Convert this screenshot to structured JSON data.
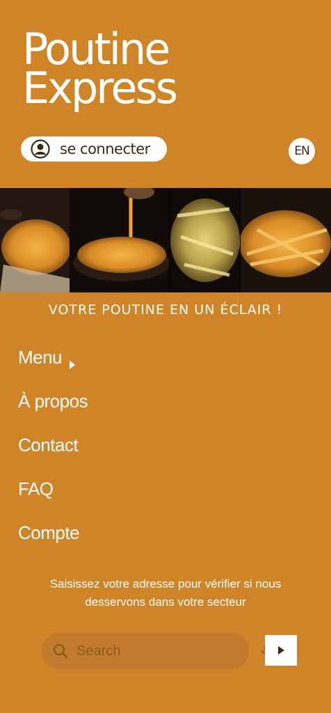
{
  "brand": {
    "line1": "Poutine",
    "line2": "Express"
  },
  "header": {
    "login_label": "se connecter",
    "lang_label": "EN"
  },
  "tagline": "VOTRE POUTINE EN UN ÉCLAIR !",
  "nav": {
    "items": [
      {
        "label": "Menu",
        "has_submenu": true
      },
      {
        "label": "À propos"
      },
      {
        "label": "Contact"
      },
      {
        "label": "FAQ"
      },
      {
        "label": "Compte"
      }
    ]
  },
  "info": {
    "line1": "Saisissez votre adresse pour vérifier si nous",
    "line2": "desservons dans votre secteur"
  },
  "search": {
    "placeholder": "Search"
  },
  "colors": {
    "background": "#CF8427",
    "text": "#FFFFFF",
    "search_bg": "#C27B2C"
  }
}
